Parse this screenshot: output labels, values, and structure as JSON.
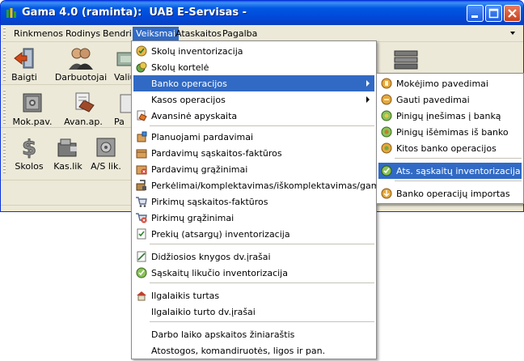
{
  "window": {
    "title": "Gama 4.0 (raminta):  UAB E-Servisas -"
  },
  "menubar": {
    "items": [
      "Rinkmenos",
      "Rodinys",
      "Bendri",
      "Veiksmai",
      "Ataskaitos",
      "Pagalba"
    ],
    "active": "Veiksmai"
  },
  "toolbar": {
    "row1": [
      "Baigti",
      "Darbuotojai",
      "Valiu"
    ],
    "row2": [
      "Mok.pav.",
      "Avan.ap.",
      "Pa"
    ],
    "row3": [
      "Skolos",
      "Kas.lik",
      "A/S lik."
    ]
  },
  "veiksmai_menu": {
    "items": [
      {
        "label": "Skolų inventorizacija",
        "icon": "debt-inventory-icon"
      },
      {
        "label": "Skolų kortelė",
        "icon": "debt-card-icon"
      },
      {
        "label": "Banko operacijos",
        "icon": "",
        "submenu": true,
        "selected": true
      },
      {
        "label": "Kasos operacijos",
        "icon": "",
        "submenu": true
      },
      {
        "label": "Avansinė apyskaita",
        "icon": "advance-report-icon"
      },
      {
        "label": "Planuojami pardavimai",
        "icon": "planned-sales-icon"
      },
      {
        "label": "Pardavimų sąskaitos-faktūros",
        "icon": "sales-invoice-icon"
      },
      {
        "label": "Pardavimų grąžinimai",
        "icon": "sales-return-icon"
      },
      {
        "label": "Perkėlimai/komplektavimas/iškomplektavimas/gamyba",
        "icon": "transfer-icon"
      },
      {
        "label": "Pirkimų sąskaitos-faktūros",
        "icon": "purchase-invoice-icon"
      },
      {
        "label": "Pirkimų grąžinimai",
        "icon": "purchase-return-icon"
      },
      {
        "label": "Prekių (atsargų) inventorizacija",
        "icon": "stock-inventory-icon"
      },
      {
        "label": "Didžiosios knygos dv.įrašai",
        "icon": "ledger-entry-icon"
      },
      {
        "label": "Sąskaitų likučio inventorizacija",
        "icon": "account-balance-icon"
      },
      {
        "label": "Ilgalaikis turtas",
        "icon": "fixed-asset-icon"
      },
      {
        "label": "Ilgalaikio turto dv.įrašai",
        "icon": ""
      },
      {
        "label": "Darbo laiko apskaitos žiniaraštis",
        "icon": ""
      },
      {
        "label": "Atostogos, komandiruotės, ligos ir pan.",
        "icon": ""
      }
    ]
  },
  "banko_submenu": {
    "items": [
      {
        "label": "Mokėjimo pavedimai",
        "icon": "payment-order-icon"
      },
      {
        "label": "Gauti pavedimai",
        "icon": "received-transfer-icon"
      },
      {
        "label": "Pinigų įnešimas į banką",
        "icon": "bank-deposit-icon"
      },
      {
        "label": "Pinigų išėmimas iš banko",
        "icon": "bank-withdrawal-icon"
      },
      {
        "label": "Kitos banko operacijos",
        "icon": "other-bank-ops-icon"
      },
      {
        "label": "Ats. sąskaitų inventorizacija",
        "icon": "account-check-icon",
        "selected": true
      },
      {
        "label": "Banko operacijų importas",
        "icon": "bank-import-icon"
      }
    ]
  },
  "colors": {
    "title_bar": "#0058e2",
    "highlight": "#316ac5",
    "window_bg": "#ece9d8"
  }
}
